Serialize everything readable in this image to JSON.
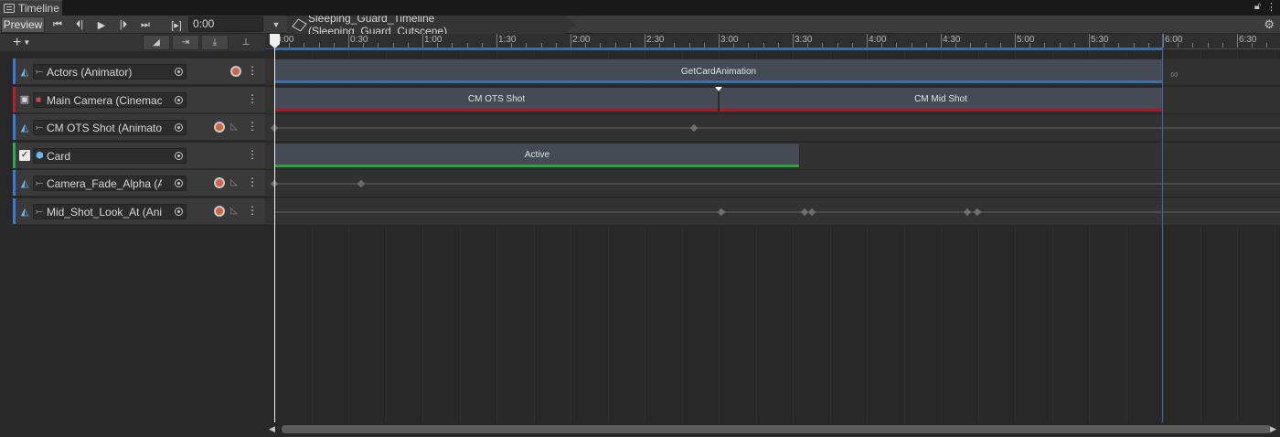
{
  "window": {
    "tab_title": "Timeline"
  },
  "toolbar": {
    "preview_label": "Preview",
    "frame_toggle_label": "[▸]",
    "time_value": "0:00",
    "breadcrumb": "Sleeping_Guard_Timeline (Sleeping_Guard_Cutscene)"
  },
  "ruler": {
    "labels": [
      "0:00",
      "0:30",
      "1:00",
      "1:30",
      "2:00",
      "2:30",
      "3:00",
      "3:30",
      "4:00",
      "4:30",
      "5:00",
      "5:30",
      "6:00",
      "6:30"
    ]
  },
  "tracks": [
    {
      "name": "Actors (Animator)",
      "color": "#3a7bd5",
      "type": "animation",
      "record": true,
      "curves": false
    },
    {
      "name": "Main Camera (Cinemac",
      "color": "#b3222c",
      "type": "cinemachine",
      "record": false,
      "curves": false
    },
    {
      "name": "CM OTS Shot (Animator",
      "color": "#3a7bd5",
      "type": "animation",
      "record": true,
      "curves": true
    },
    {
      "name": "Card",
      "color": "#2fa84f",
      "type": "activation",
      "record": false,
      "curves": false
    },
    {
      "name": "Camera_Fade_Alpha (An",
      "color": "#3a7bd5",
      "type": "animation",
      "record": true,
      "curves": true
    },
    {
      "name": "Mid_Shot_Look_At (Anin",
      "color": "#3a7bd5",
      "type": "animation",
      "record": true,
      "curves": true
    }
  ],
  "clips": {
    "actors": {
      "label": "GetCardAnimation",
      "strip_color": "#3a6fb0"
    },
    "camera_a": {
      "label": "CM OTS Shot",
      "strip_color": "#a01c26"
    },
    "camera_b": {
      "label": "CM Mid Shot",
      "strip_color": "#a01c26"
    },
    "card": {
      "label": "Active",
      "strip_color": "#2aa838"
    }
  },
  "colors": {
    "animation_track": "#3a7bd5",
    "cinemachine_track": "#b3222c",
    "activation_track": "#2fa84f",
    "record_button": "#d16442",
    "end_marker": "#3a6aa5"
  },
  "icons": {
    "window": "timeline-window-icon",
    "lock": "lock-icon",
    "menu": "window-menu-icon",
    "settings": "gear-icon"
  }
}
